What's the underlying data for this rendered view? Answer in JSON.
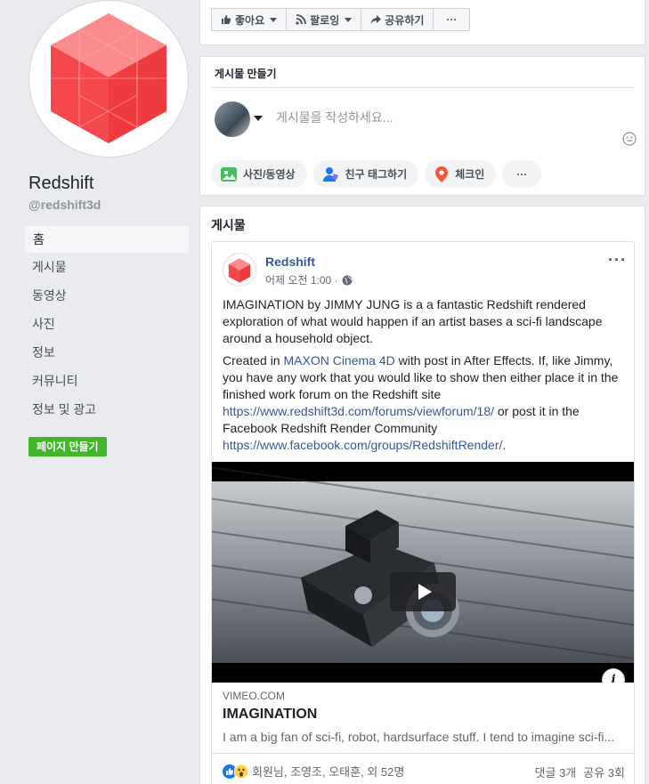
{
  "page": {
    "name": "Redshift",
    "handle": "@redshift3d",
    "brand_color": "#f5484c"
  },
  "sidebar": {
    "items": [
      {
        "label": "홈",
        "active": true
      },
      {
        "label": "게시물"
      },
      {
        "label": "동영상"
      },
      {
        "label": "사진"
      },
      {
        "label": "정보"
      },
      {
        "label": "커뮤니티"
      },
      {
        "label": "정보 및 광고"
      }
    ],
    "create_page_label": "페이지 만들기"
  },
  "actionbar": {
    "like_label": "좋아요",
    "follow_label": "팔로잉",
    "share_label": "공유하기",
    "more_label": "···"
  },
  "composer": {
    "title": "게시물 만들기",
    "placeholder": "게시물을 작성하세요...",
    "chips": {
      "photo": "사진/동영상",
      "tag": "친구 태그하기",
      "checkin": "체크인",
      "more": "···"
    }
  },
  "feed": {
    "title": "게시물",
    "post": {
      "author": "Redshift",
      "time": "어제 오전 1:00 ·",
      "more": "···",
      "para1": "IMAGINATION by JIMMY JUNG is a a fantastic Redshift rendered exploration of what would happen if an artist bases a sci-fi landscape around a household object.",
      "para2_a": "Created in ",
      "para2_link": "MAXON Cinema 4D",
      "para2_b": " with post in After Effects. If, like Jimmy, you have any work that you would like to show then either place it in the finished work forum on the Redshift site ",
      "para2_url1": "https://www.redshift3d.com/forums/viewforum/18/",
      "para2_c": " or post it in the Facebook Redshift Render Community ",
      "para2_url2": "https://www.facebook.com/groups/RedshiftRender/",
      "para2_d": ".",
      "link_domain": "VIMEO.COM",
      "link_title": "IMAGINATION",
      "link_desc": "I am a big fan of sci-fi, robot, hardsurface stuff. I tend to imagine sci-fi...",
      "info_glyph": "i",
      "reactions_text": "회원님, 조영조, 오태훈, 외 52명",
      "comments": "댓글 3개",
      "shares": "공유 3회"
    }
  }
}
